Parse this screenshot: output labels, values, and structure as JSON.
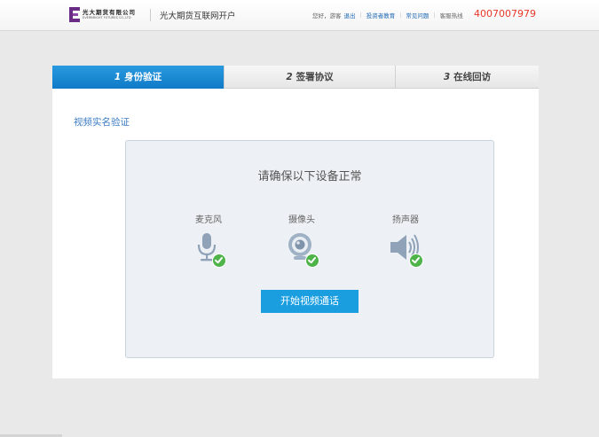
{
  "header": {
    "logo_cn": "光大期货有限公司",
    "logo_en": "EVERBRIGHT FUTURES CO.,LTD",
    "site_title": "光大期货互联网开户",
    "greeting": "您好，游客",
    "logout": "退出",
    "investor_edu": "投资者教育",
    "faq": "常见问题",
    "hotline_label": "客服热线",
    "hotline_number": "4007007979"
  },
  "steps": [
    {
      "num": "1",
      "label": "身份验证",
      "active": true
    },
    {
      "num": "2",
      "label": "签署协议",
      "active": false
    },
    {
      "num": "3",
      "label": "在线回访",
      "active": false
    }
  ],
  "section_title": "视频实名验证",
  "device_check": {
    "heading": "请确保以下设备正常",
    "devices": [
      {
        "label": "麦克风",
        "icon": "microphone-icon",
        "ok": true
      },
      {
        "label": "摄像头",
        "icon": "webcam-icon",
        "ok": true
      },
      {
        "label": "扬声器",
        "icon": "speaker-icon",
        "ok": true
      }
    ],
    "start_button": "开始视频通话"
  },
  "colors": {
    "accent": "#1a9ee0",
    "hotline": "#e8382b",
    "check": "#4eb449",
    "link": "#1a66b3"
  }
}
